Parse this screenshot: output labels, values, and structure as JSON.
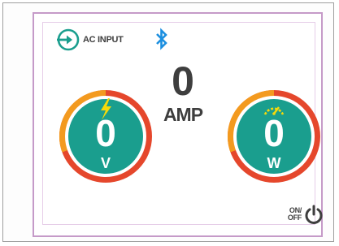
{
  "header": {
    "input_source_label": "AC INPUT",
    "input_icon": "ac-input-arrow-icon",
    "bluetooth_icon": "bluetooth-icon"
  },
  "amperage": {
    "value": "0",
    "unit": "AMP"
  },
  "voltage_gauge": {
    "value": "0",
    "unit": "V",
    "icon": "lightning-bolt-icon"
  },
  "wattage_gauge": {
    "value": "0",
    "unit": "W",
    "icon": "speedometer-icon"
  },
  "power": {
    "label_line1": "ON/",
    "label_line2": "OFF",
    "icon": "power-icon"
  },
  "colors": {
    "teal": "#1a9e8e",
    "ring_orange": "#f39a1f",
    "ring_red": "#e5472c",
    "bolt_yellow": "#f5d90a",
    "bluetooth_blue": "#1c8fe0",
    "text_dark": "#3e3e3e",
    "panel_border": "#c59ac8"
  }
}
